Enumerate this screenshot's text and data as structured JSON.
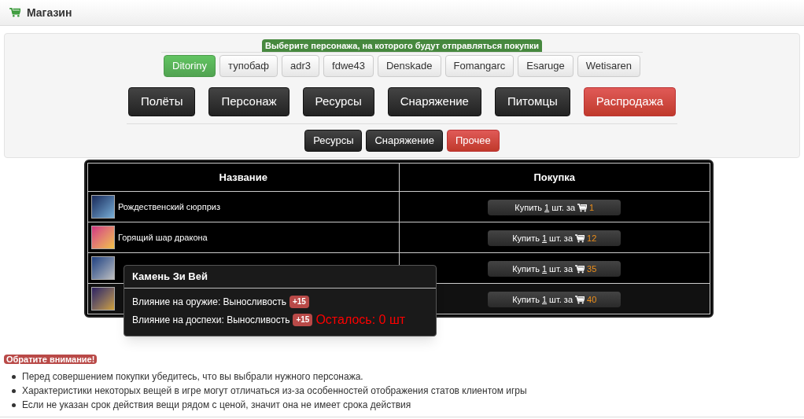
{
  "header": {
    "title": "Магазин"
  },
  "hint": "Выберите персонажа, на которого будут отправляться покупки",
  "characters": [
    {
      "label": "Ditoriny",
      "selected": true
    },
    {
      "label": "тупобаф",
      "selected": false
    },
    {
      "label": "adr3",
      "selected": false
    },
    {
      "label": "fdwe43",
      "selected": false
    },
    {
      "label": "Denskade",
      "selected": false
    },
    {
      "label": "Fomangarc",
      "selected": false
    },
    {
      "label": "Esaruge",
      "selected": false
    },
    {
      "label": "Wetisaren",
      "selected": false
    }
  ],
  "categories": [
    {
      "label": "Полёты",
      "kind": "dark"
    },
    {
      "label": "Персонаж",
      "kind": "dark"
    },
    {
      "label": "Ресурсы",
      "kind": "dark"
    },
    {
      "label": "Снаряжение",
      "kind": "dark"
    },
    {
      "label": "Питомцы",
      "kind": "dark"
    },
    {
      "label": "Распродажа",
      "kind": "red"
    }
  ],
  "subcategories": [
    {
      "label": "Ресурсы",
      "kind": "dark"
    },
    {
      "label": "Снаряжение",
      "kind": "dark"
    },
    {
      "label": "Прочее",
      "kind": "red"
    }
  ],
  "table": {
    "columns": [
      "Название",
      "Покупка"
    ],
    "rows": [
      {
        "name": "Рождественский сюрприз",
        "buy": "Купить",
        "quantity": "1",
        "unit": "шт. за",
        "price": "1"
      },
      {
        "name": "Горящий шар дракона",
        "buy": "Купить",
        "quantity": "1",
        "unit": "шт. за",
        "price": "12"
      },
      {
        "buy": "Купить",
        "quantity": "1",
        "unit": "шт. за",
        "price": "35"
      },
      {
        "buy": "Купить",
        "quantity": "1",
        "unit": "шт. за",
        "price": "40"
      }
    ]
  },
  "tooltip": {
    "title": "Камень Зи Вей",
    "lines": [
      {
        "text": "Влияние на оружие: Выносливость",
        "badge": "+15"
      },
      {
        "text": "Влияние на доспехи: Выносливость",
        "badge": "+15"
      }
    ],
    "stock": "Осталось: 0 шт"
  },
  "notice": {
    "label": "Обратите внимание!",
    "items": [
      "Перед совершением покупки убедитесь, что вы выбрали нужного персонажа.",
      "Характеристики некоторых вещей в игре могут отличаться из-за особенностей отображения статов клиентом игры",
      "Если не указан срок действия вещи рядом с ценой, значит она не имеет срока действия"
    ]
  }
}
